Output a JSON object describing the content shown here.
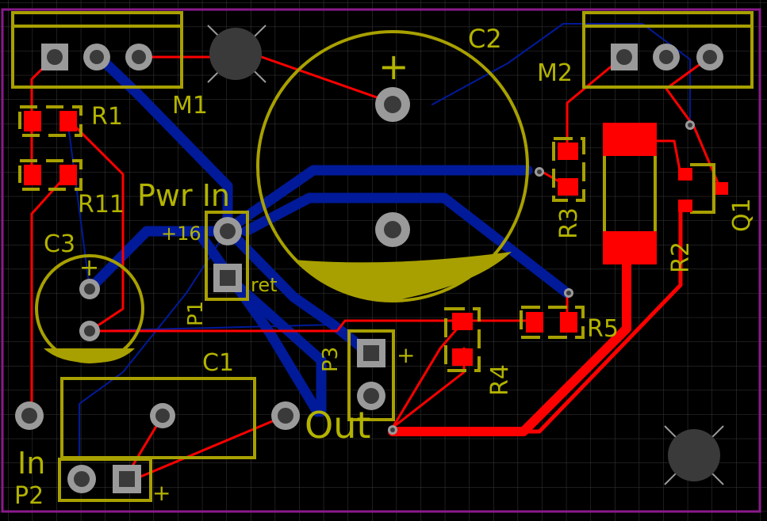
{
  "colors": {
    "background": "#000000",
    "grid": "#3a3a3a",
    "outline": "#8a1a8a",
    "top_copper": "#ff0000",
    "bottom_copper": "#001a99",
    "silkscreen": "#a8a000",
    "pad": "#9a9a9a",
    "hole": "#3a3a3a"
  },
  "labels": {
    "m1": "M1",
    "m2": "M2",
    "c1": "C1",
    "c2": "C2",
    "c3": "C3",
    "r1": "R1",
    "r11": "R11",
    "r2": "R2",
    "r3": "R3",
    "r4": "R4",
    "r5": "R5",
    "q1": "Q1",
    "p1": "P1",
    "p2": "P2",
    "p3": "P3",
    "pwr_in": "Pwr In",
    "plus16": "+16",
    "ret": "ret",
    "out": "Out",
    "in": "In",
    "plus": "+"
  }
}
